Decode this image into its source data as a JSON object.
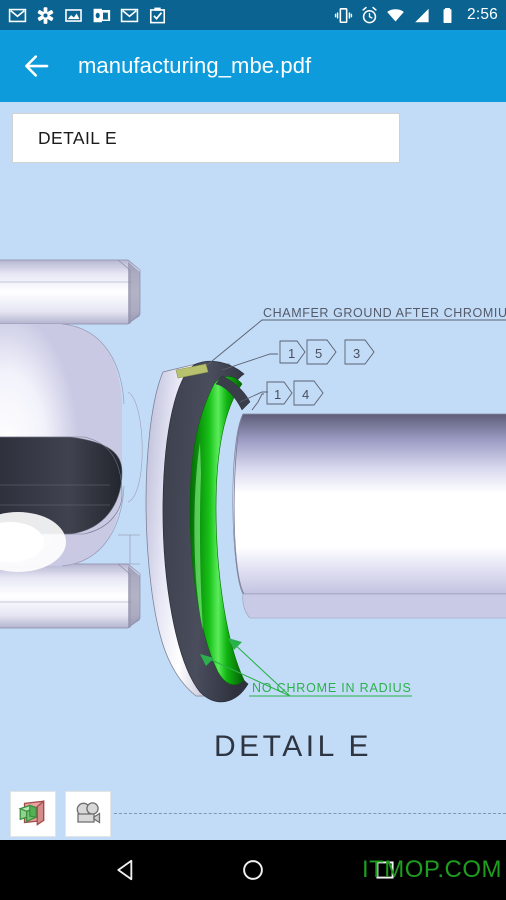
{
  "status_bar": {
    "time": "2:56",
    "left_icons": [
      "gmail-icon",
      "settings-gear-icon",
      "photo-icon",
      "outlook-icon",
      "gmail-icon-2",
      "clipboard-check-icon"
    ],
    "right_icons": [
      "vibrate-icon",
      "alarm-clock-icon",
      "wifi-icon",
      "signal-icon",
      "battery-icon"
    ],
    "background_color": "#0A6391"
  },
  "app_bar": {
    "back_label": "back-arrow",
    "title": "manufacturing_mbe.pdf",
    "background_color": "#0D9BDC"
  },
  "viewer": {
    "background_color": "#C2DCF7",
    "detail_field": {
      "value": "DETAIL E",
      "placeholder": "DETAIL E"
    },
    "drawing": {
      "title_label": "DETAIL  E",
      "annotations": [
        {
          "id": "chamfer-note",
          "text": "CHAMFER  GROUND  AFTER  CHROMIU",
          "color": "#53596b"
        },
        {
          "id": "no-chrome-note",
          "text": "NO  CHROME  IN  RADIUS",
          "color": "#2bb14b"
        }
      ],
      "flag_notes_row1": [
        "1",
        "5",
        "3"
      ],
      "flag_notes_row2": [
        "1",
        "4"
      ],
      "highlight_color": "#11B411",
      "chamfer_highlight_color": "#b6bf6a",
      "body_color": "#c9c9e4"
    },
    "tools": [
      {
        "id": "model-3d-button",
        "label": "3d-model-icon"
      },
      {
        "id": "camera-view-button",
        "label": "camera-icon"
      }
    ]
  },
  "nav_bar": {
    "back": "nav-back-triangle",
    "home": "nav-home-circle",
    "recents": "nav-recents-square",
    "watermark": "ITMOP.COM",
    "watermark_color": "#1E9E1E"
  }
}
